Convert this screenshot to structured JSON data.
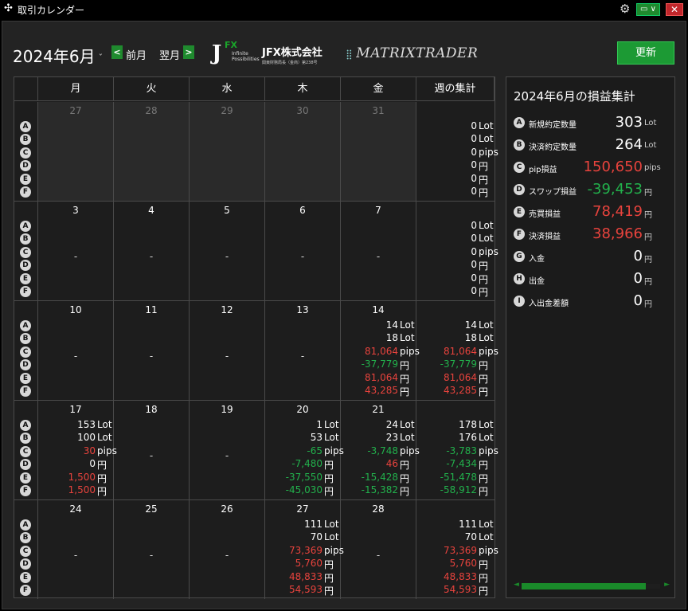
{
  "window": {
    "title": "取引カレンダー",
    "move_icon": "✣",
    "gear_icon": "⚙",
    "window_btn": "▭ ∨",
    "close_btn": "✕"
  },
  "header": {
    "month": "2024年6月",
    "month_caret": "ˇ",
    "prev_label": "前月",
    "next_label": "翌月",
    "prev_icon": "<",
    "next_icon": ">",
    "logo_jfx_letter": "J",
    "logo_jfx_fx": "FX",
    "logo_jfx_tag": "Infinite Possibilities",
    "logo_company": "JFX株式会社",
    "logo_company_sub": "関東財務局長（金商）第238号",
    "logo_trader": "MATRIXTRADER",
    "refresh_label": "更新"
  },
  "calendar": {
    "headers": [
      "月",
      "火",
      "水",
      "木",
      "金",
      "週の集計"
    ],
    "row_labels": [
      "A",
      "B",
      "C",
      "D",
      "E",
      "F"
    ],
    "weeks": [
      {
        "days": [
          {
            "day": "27",
            "past": true
          },
          {
            "day": "28",
            "past": true
          },
          {
            "day": "29",
            "past": true
          },
          {
            "day": "30",
            "past": true
          },
          {
            "day": "31",
            "past": true
          }
        ],
        "summary": [
          [
            "0",
            "Lot",
            "wht"
          ],
          [
            "0",
            "Lot",
            "wht"
          ],
          [
            "0",
            "pips",
            "wht"
          ],
          [
            "0",
            "円",
            "wht"
          ],
          [
            "0",
            "円",
            "wht"
          ],
          [
            "0",
            "円",
            "wht"
          ]
        ]
      },
      {
        "days": [
          {
            "day": "3",
            "dash": "-"
          },
          {
            "day": "4",
            "dash": "-"
          },
          {
            "day": "5",
            "dash": "-"
          },
          {
            "day": "6",
            "dash": "-"
          },
          {
            "day": "7",
            "dash": "-"
          }
        ],
        "summary": [
          [
            "0",
            "Lot",
            "wht"
          ],
          [
            "0",
            "Lot",
            "wht"
          ],
          [
            "0",
            "pips",
            "wht"
          ],
          [
            "0",
            "円",
            "wht"
          ],
          [
            "0",
            "円",
            "wht"
          ],
          [
            "0",
            "円",
            "wht"
          ]
        ]
      },
      {
        "days": [
          {
            "day": "10",
            "dash": "-"
          },
          {
            "day": "11",
            "dash": "-"
          },
          {
            "day": "12",
            "dash": "-"
          },
          {
            "day": "13",
            "dash": "-"
          },
          {
            "day": "14",
            "vals": [
              [
                "14",
                "Lot",
                "wht"
              ],
              [
                "18",
                "Lot",
                "wht"
              ],
              [
                "81,064",
                "pips",
                "red"
              ],
              [
                "-37,779",
                "円",
                "grn"
              ],
              [
                "81,064",
                "円",
                "red"
              ],
              [
                "43,285",
                "円",
                "red"
              ]
            ]
          }
        ],
        "summary": [
          [
            "14",
            "Lot",
            "wht"
          ],
          [
            "18",
            "Lot",
            "wht"
          ],
          [
            "81,064",
            "pips",
            "red"
          ],
          [
            "-37,779",
            "円",
            "grn"
          ],
          [
            "81,064",
            "円",
            "red"
          ],
          [
            "43,285",
            "円",
            "red"
          ]
        ]
      },
      {
        "days": [
          {
            "day": "17",
            "vals": [
              [
                "153",
                "Lot",
                "wht"
              ],
              [
                "100",
                "Lot",
                "wht"
              ],
              [
                "30",
                "pips",
                "red"
              ],
              [
                "0",
                "円",
                "wht"
              ],
              [
                "1,500",
                "円",
                "red"
              ],
              [
                "1,500",
                "円",
                "red"
              ]
            ]
          },
          {
            "day": "18",
            "dash": "-"
          },
          {
            "day": "19",
            "dash": "-"
          },
          {
            "day": "20",
            "vals": [
              [
                "1",
                "Lot",
                "wht"
              ],
              [
                "53",
                "Lot",
                "wht"
              ],
              [
                "-65",
                "pips",
                "grn"
              ],
              [
                "-7,480",
                "円",
                "grn"
              ],
              [
                "-37,550",
                "円",
                "grn"
              ],
              [
                "-45,030",
                "円",
                "grn"
              ]
            ]
          },
          {
            "day": "21",
            "vals": [
              [
                "24",
                "Lot",
                "wht"
              ],
              [
                "23",
                "Lot",
                "wht"
              ],
              [
                "-3,748",
                "pips",
                "grn"
              ],
              [
                "46",
                "円",
                "red"
              ],
              [
                "-15,428",
                "円",
                "grn"
              ],
              [
                "-15,382",
                "円",
                "grn"
              ]
            ]
          }
        ],
        "summary": [
          [
            "178",
            "Lot",
            "wht"
          ],
          [
            "176",
            "Lot",
            "wht"
          ],
          [
            "-3,783",
            "pips",
            "grn"
          ],
          [
            "-7,434",
            "円",
            "grn"
          ],
          [
            "-51,478",
            "円",
            "grn"
          ],
          [
            "-58,912",
            "円",
            "grn"
          ]
        ]
      },
      {
        "days": [
          {
            "day": "24",
            "dash": "-"
          },
          {
            "day": "25",
            "dash": "-"
          },
          {
            "day": "26",
            "dash": "-"
          },
          {
            "day": "27",
            "vals": [
              [
                "111",
                "Lot",
                "wht"
              ],
              [
                "70",
                "Lot",
                "wht"
              ],
              [
                "73,369",
                "pips",
                "red"
              ],
              [
                "5,760",
                "円",
                "red"
              ],
              [
                "48,833",
                "円",
                "red"
              ],
              [
                "54,593",
                "円",
                "red"
              ]
            ]
          },
          {
            "day": "28",
            "dash": "-"
          }
        ],
        "summary": [
          [
            "111",
            "Lot",
            "wht"
          ],
          [
            "70",
            "Lot",
            "wht"
          ],
          [
            "73,369",
            "pips",
            "red"
          ],
          [
            "5,760",
            "円",
            "red"
          ],
          [
            "48,833",
            "円",
            "red"
          ],
          [
            "54,593",
            "円",
            "red"
          ]
        ]
      }
    ]
  },
  "summary": {
    "title": "2024年6月の損益集計",
    "rows": [
      {
        "key": "A",
        "label": "新規約定数量",
        "value": "303",
        "unit": "Lot",
        "color": "wht"
      },
      {
        "key": "B",
        "label": "決済約定数量",
        "value": "264",
        "unit": "Lot",
        "color": "wht"
      },
      {
        "key": "C",
        "label": "pip損益",
        "value": "150,650",
        "unit": "pips",
        "color": "red"
      },
      {
        "key": "D",
        "label": "スワップ損益",
        "value": "-39,453",
        "unit": "円",
        "color": "grn"
      },
      {
        "key": "E",
        "label": "売買損益",
        "value": "78,419",
        "unit": "円",
        "color": "red"
      },
      {
        "key": "F",
        "label": "決済損益",
        "value": "38,966",
        "unit": "円",
        "color": "red"
      },
      {
        "key": "G",
        "label": "入金",
        "value": "0",
        "unit": "円",
        "color": "wht"
      },
      {
        "key": "H",
        "label": "出金",
        "value": "0",
        "unit": "円",
        "color": "wht"
      },
      {
        "key": "I",
        "label": "入出金差額",
        "value": "0",
        "unit": "円",
        "color": "wht"
      }
    ],
    "scroll_left": "◄",
    "scroll_right": "►"
  }
}
